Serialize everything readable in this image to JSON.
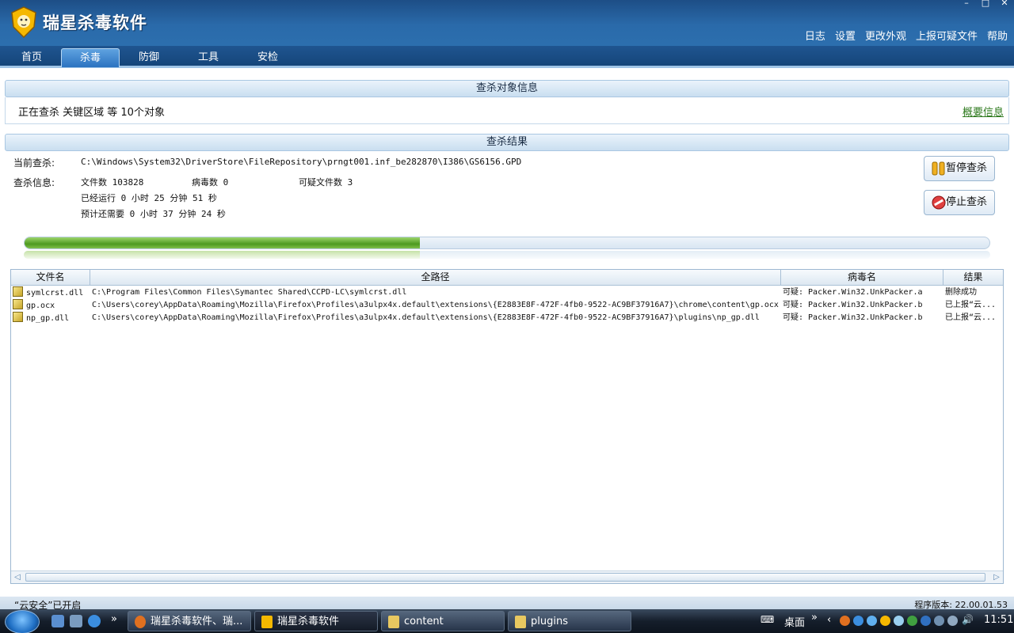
{
  "app": {
    "title": "瑞星杀毒软件",
    "window_controls": [
      "–",
      "□",
      "✕"
    ]
  },
  "top_links": [
    "日志",
    "设置",
    "更改外观",
    "上报可疑文件",
    "帮助"
  ],
  "tabs": [
    {
      "label": "首页",
      "active": false
    },
    {
      "label": "杀毒",
      "active": true
    },
    {
      "label": "防御",
      "active": false
    },
    {
      "label": "工具",
      "active": false
    },
    {
      "label": "安检",
      "active": false
    }
  ],
  "scan_target": {
    "header": "查杀对象信息",
    "text": "正在查杀 关键区域 等 10个对象",
    "summary_link": "概要信息"
  },
  "scan_result": {
    "header": "查杀结果",
    "current_label": "当前查杀:",
    "current_path": "C:\\Windows\\System32\\DriverStore\\FileRepository\\prngt001.inf_be282870\\I386\\GS6156.GPD",
    "info_label": "查杀信息:",
    "files_count": "文件数 103828",
    "virus_count": "病毒数 0",
    "suspicious_count": "可疑文件数 3",
    "elapsed": "已经运行 0 小时 25 分钟 51  秒",
    "remaining": "预计还需要 0 小时 37 分钟 24  秒",
    "pause_button": "暂停查杀",
    "stop_button": "停止查杀",
    "progress": 0.41
  },
  "table": {
    "columns": [
      "文件名",
      "全路径",
      "病毒名",
      "结果"
    ],
    "rows": [
      {
        "name": "symlcrst.dll",
        "path": "C:\\Program Files\\Common Files\\Symantec Shared\\CCPD-LC\\symlcrst.dll",
        "virus": "可疑: Packer.Win32.UnkPacker.a",
        "result": "删除成功"
      },
      {
        "name": "gp.ocx",
        "path": "C:\\Users\\corey\\AppData\\Roaming\\Mozilla\\Firefox\\Profiles\\a3ulpx4x.default\\extensions\\{E2883E8F-472F-4fb0-9522-AC9BF37916A7}\\chrome\\content\\gp.ocx",
        "virus": "可疑: Packer.Win32.UnkPacker.b",
        "result": "已上报“云..."
      },
      {
        "name": "np_gp.dll",
        "path": "C:\\Users\\corey\\AppData\\Roaming\\Mozilla\\Firefox\\Profiles\\a3ulpx4x.default\\extensions\\{E2883E8F-472F-4fb0-9522-AC9BF37916A7}\\plugins\\np_gp.dll",
        "virus": "可疑: Packer.Win32.UnkPacker.b",
        "result": "已上报“云..."
      }
    ]
  },
  "status": {
    "left": "“云安全”已开启",
    "right": "程序版本: 22.00.01.53"
  },
  "taskbar": {
    "items": [
      {
        "label": "瑞星杀毒软件、瑞...",
        "active": false
      },
      {
        "label": "瑞星杀毒软件",
        "active": true
      },
      {
        "label": "content",
        "active": false
      },
      {
        "label": "plugins",
        "active": false
      }
    ],
    "desktop_label": "桌面",
    "overflow": "»",
    "clock": "11:51"
  },
  "colors": {
    "titlebar": "#2a6aaa",
    "progress_fill": "#4d9a1f",
    "link_green": "#2e7a1e"
  }
}
